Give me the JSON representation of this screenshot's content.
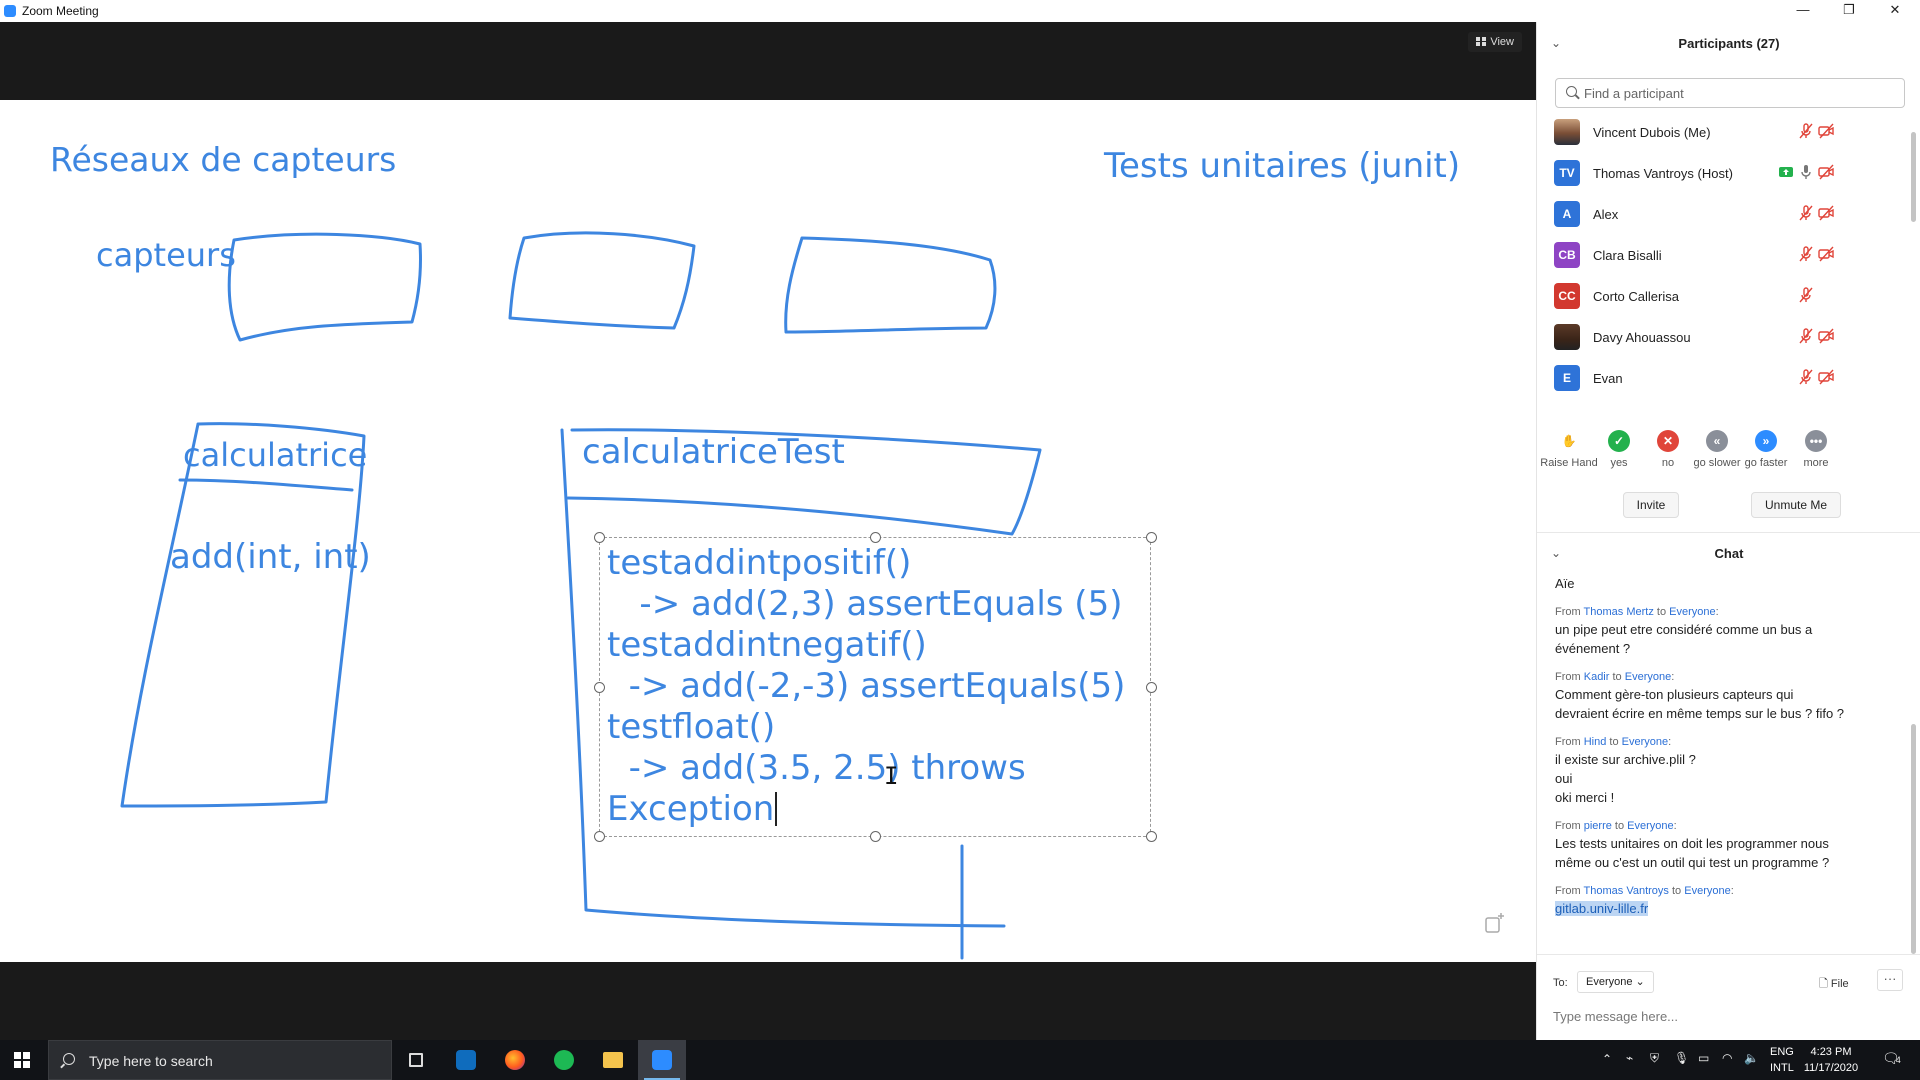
{
  "window": {
    "title": "Zoom Meeting",
    "controls": {
      "minimize": "—",
      "restore": "❐",
      "close": "✕"
    }
  },
  "stage": {
    "view_label": "View",
    "whiteboard": {
      "heading_left": "Réseaux de capteurs",
      "heading_right": "Tests unitaires (junit)",
      "label_capteurs": "capteurs",
      "label_calculatrice": "calculatrice",
      "label_add": "add(int, int)",
      "label_calctest": "calculatriceTest",
      "code_lines": [
        "testaddintpositif()",
        "   -> add(2,3) assertEquals (5)",
        "testaddintnegatif()",
        "  -> add(-2,-3) assertEquals(5)",
        "testfloat()",
        "  -> add(3.5, 2.5) throws",
        "Exception"
      ],
      "stroke_color": "#3d86e0"
    }
  },
  "participants": {
    "title": "Participants (27)",
    "search_placeholder": "Find a participant",
    "list": [
      {
        "name": "Vincent Dubois (Me)",
        "initials": "",
        "avatar": "photo",
        "color": "",
        "mic": "muted",
        "video": "off",
        "share": false
      },
      {
        "name": "Thomas Vantroys (Host)",
        "initials": "TV",
        "avatar": "initials",
        "color": "#2e73d8",
        "mic": "on",
        "video": "off",
        "share": true
      },
      {
        "name": "Alex",
        "initials": "A",
        "avatar": "initials",
        "color": "#2e73d8",
        "mic": "muted",
        "video": "off",
        "share": false
      },
      {
        "name": "Clara Bisalli",
        "initials": "CB",
        "avatar": "initials",
        "color": "#8e44c4",
        "mic": "muted",
        "video": "off",
        "share": false
      },
      {
        "name": "Corto Callerisa",
        "initials": "CC",
        "avatar": "initials",
        "color": "#d2382f",
        "mic": "muted",
        "video": "none",
        "share": false
      },
      {
        "name": "Davy Ahouassou",
        "initials": "",
        "avatar": "photo2",
        "color": "",
        "mic": "muted",
        "video": "off",
        "share": false
      },
      {
        "name": "Evan",
        "initials": "E",
        "avatar": "initials",
        "color": "#2e73d8",
        "mic": "muted",
        "video": "off",
        "share": false
      }
    ],
    "reactions": [
      {
        "label": "Raise Hand",
        "icon": "raise-hand-icon",
        "glyph": "✋",
        "color": "#4a90e2"
      },
      {
        "label": "yes",
        "icon": "check-icon",
        "glyph": "✓",
        "color": "#23b14d"
      },
      {
        "label": "no",
        "icon": "x-icon",
        "glyph": "✕",
        "color": "#e0453a"
      },
      {
        "label": "go slower",
        "icon": "rewind-icon",
        "glyph": "«",
        "color": "#8a8f99"
      },
      {
        "label": "go faster",
        "icon": "fast-forward-icon",
        "glyph": "»",
        "color": "#2d8cff"
      },
      {
        "label": "more",
        "icon": "more-icon",
        "glyph": "•••",
        "color": "#8a8f99"
      }
    ],
    "invite_label": "Invite",
    "unmute_label": "Unmute Me"
  },
  "chat": {
    "title": "Chat",
    "first_line": "Aïe",
    "messages": [
      {
        "from": "Thomas Mertz",
        "to": "Everyone",
        "lines": [
          "un pipe peut etre considéré comme un bus a",
          "événement ?"
        ]
      },
      {
        "from": "Kadir",
        "to": "Everyone",
        "lines": [
          "Comment gère-ton plusieurs capteurs qui",
          "devraient écrire en même temps sur le bus ? fifo ?"
        ]
      },
      {
        "from": "Hind",
        "to": "Everyone",
        "lines": [
          "il existe sur archive.plil ?",
          "oui",
          "oki merci !"
        ]
      },
      {
        "from": "pierre",
        "to": "Everyone",
        "lines": [
          "Les tests unitaires on doit les programmer nous",
          "même ou c'est un outil qui test un programme ?"
        ]
      },
      {
        "from": "Thomas Vantroys",
        "to": "Everyone",
        "lines": [
          "gitlab.univ-lille.fr"
        ],
        "highlight": true
      }
    ],
    "from_word": "From",
    "to_word": "to",
    "to_label": "To:",
    "to_value": "Everyone",
    "file_label": "File",
    "more_label": "···",
    "input_placeholder": "Type message here..."
  },
  "taskbar": {
    "search_placeholder": "Type here to search",
    "lang_line1": "ENG",
    "lang_line2": "INTL",
    "time": "4:23 PM",
    "date": "11/17/2020",
    "notification_count": "4"
  }
}
